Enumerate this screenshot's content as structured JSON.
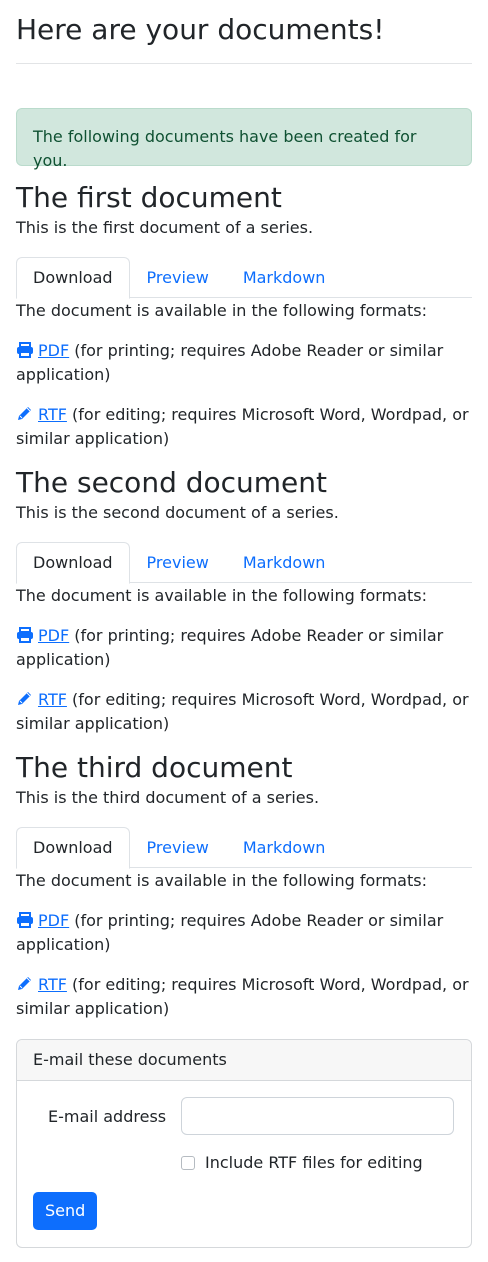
{
  "page": {
    "title": "Here are your documents!",
    "alert": "The following documents have been created for you."
  },
  "tabs": [
    "Download",
    "Preview",
    "Markdown"
  ],
  "formats_intro": "The document is available in the following formats:",
  "formats": {
    "pdf": {
      "icon": "printer-icon",
      "link": "PDF",
      "note": " (for printing; requires Adobe Reader or similar application)"
    },
    "rtf": {
      "icon": "pencil-icon",
      "link": "RTF",
      "note": " (for editing; requires Microsoft Word, Wordpad, or similar application)"
    }
  },
  "documents": [
    {
      "title": "The first document",
      "description": "This is the first document of a series."
    },
    {
      "title": "The second document",
      "description": "This is the second document of a series."
    },
    {
      "title": "The third document",
      "description": "This is the third document of a series."
    }
  ],
  "email": {
    "header": "E-mail these documents",
    "address_label": "E-mail address",
    "address_value": "",
    "include_rtf_label": "Include RTF files for editing",
    "include_rtf_checked": false,
    "send_label": "Send"
  },
  "colors": {
    "link": "#0d6efd",
    "alert_bg": "#d1e7dd",
    "alert_text": "#0f5132",
    "button": "#0d6efd"
  }
}
